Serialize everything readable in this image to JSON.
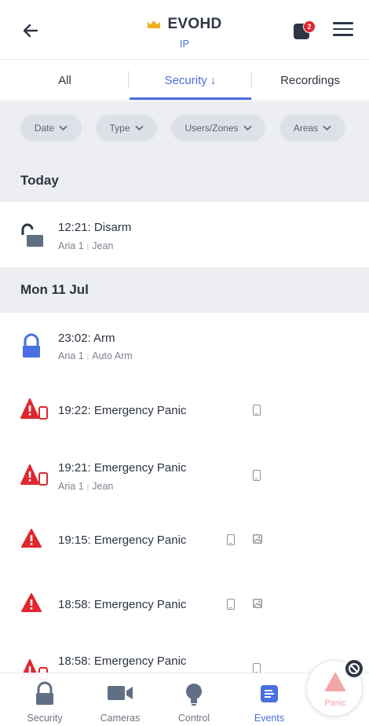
{
  "header": {
    "title": "EVOHD",
    "subtitle": "IP",
    "notification_count": "2",
    "accent_color": "#4a6fe0",
    "crown_color": "#f2b01e"
  },
  "tabs": [
    {
      "label": "All",
      "active": false
    },
    {
      "label": "Security ↓",
      "active": true
    },
    {
      "label": "Recordings",
      "active": false
    }
  ],
  "filters": [
    {
      "label": "Date"
    },
    {
      "label": "Type"
    },
    {
      "label": "Users/Zones"
    },
    {
      "label": "Areas"
    }
  ],
  "sections": [
    {
      "title": "Today"
    },
    {
      "title": "Mon 11 Jul"
    }
  ],
  "events": [
    {
      "title": "12:21: Disarm",
      "area": "Aria 1",
      "who": "Jean",
      "icon": "unlocked-padlock-icon"
    },
    {
      "title": "23:02: Arm",
      "area": "Aria 1",
      "who": "Auto Arm",
      "icon": "locked-padlock-icon"
    },
    {
      "title": "19:22: Emergency Panic",
      "icon": "panic-alarm-icon"
    },
    {
      "title": "19:21: Emergency Panic",
      "area": "Aria 1",
      "who": "Jean",
      "icon": "panic-alarm-icon"
    },
    {
      "title": "19:15: Emergency Panic",
      "icon": "warning-triangle-icon"
    },
    {
      "title": "18:58: Emergency Panic",
      "icon": "warning-triangle-icon"
    },
    {
      "title": "18:58: Emergency Panic",
      "icon": "panic-alarm-icon"
    }
  ],
  "bottom_nav": [
    {
      "label": "Security",
      "icon": "padlock-icon"
    },
    {
      "label": "Cameras",
      "icon": "camera-icon"
    },
    {
      "label": "Control",
      "icon": "lightbulb-icon"
    },
    {
      "label": "Events",
      "icon": "events-list-icon",
      "active": true
    }
  ],
  "panic": {
    "label": "Panic"
  }
}
